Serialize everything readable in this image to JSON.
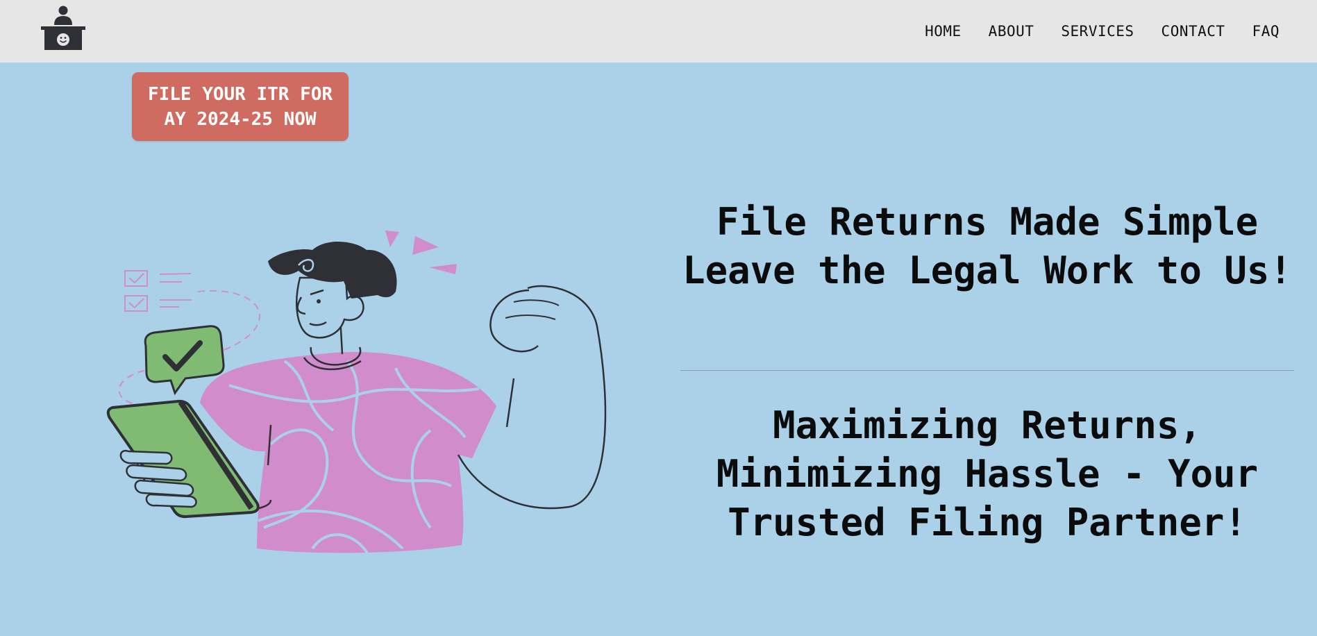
{
  "header": {
    "logo_icon": "reception-desk-smiley-icon",
    "nav": [
      "HOME",
      "ABOUT",
      "SERVICES",
      "CONTACT",
      "FAQ"
    ]
  },
  "hero": {
    "cta_label": "FILE YOUR ITR FOR AY 2024-25 NOW",
    "headline": "File Returns Made Simple Leave the Legal Work to Us!",
    "subheadline": "Maximizing Returns, Minimizing Hassle - Your Trusted Filing Partner!",
    "illustration": "man-with-phone-checkmark-illustration"
  },
  "colors": {
    "page_bg": "#abd1e8",
    "navbar_bg": "#e6e6e6",
    "cta_bg": "#d06b62",
    "shirt": "#d18ccb",
    "phone": "#7fbb73",
    "ink": "#2f3035"
  }
}
